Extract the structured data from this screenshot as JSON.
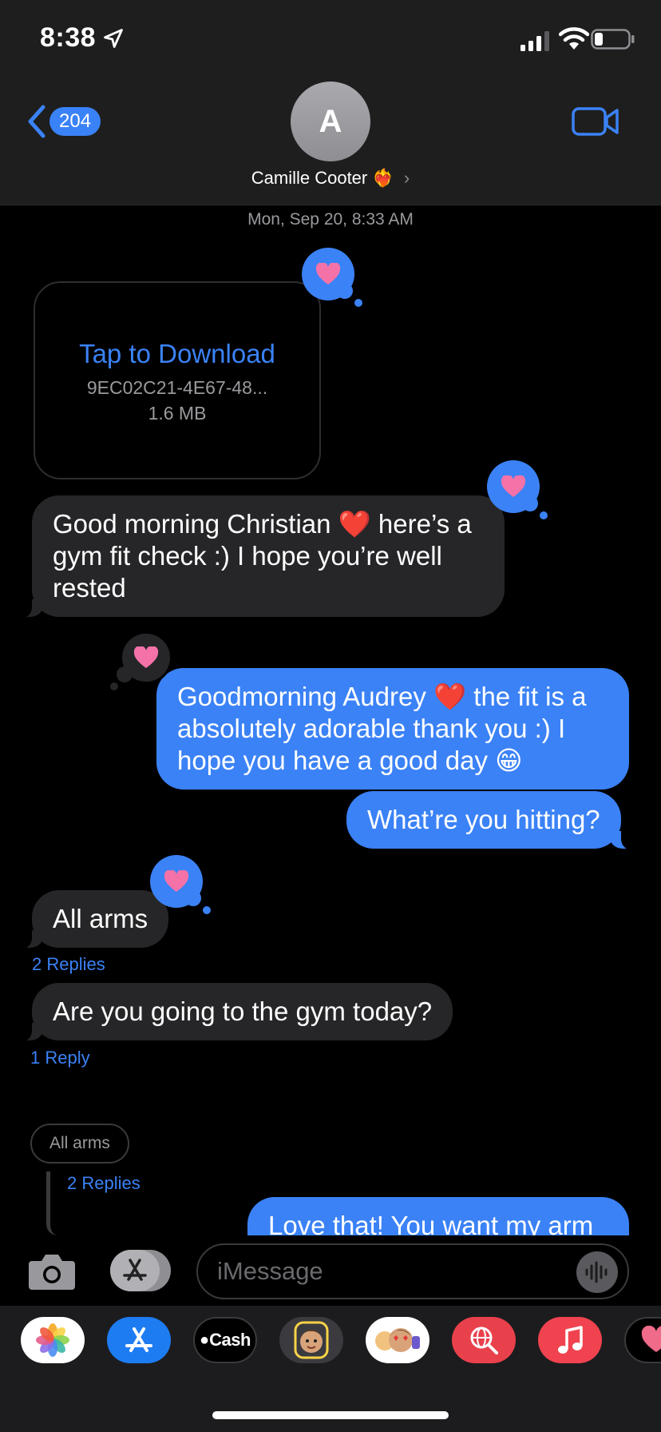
{
  "status_bar": {
    "time": "8:38"
  },
  "header": {
    "back_count": "204",
    "avatar_initial": "A",
    "contact_name": "Camille Cooter",
    "contact_emoji": "❤️‍🔥",
    "contact_chevron": "›"
  },
  "conversation": {
    "timestamp": "Mon, Sep 20, 8:33 AM",
    "attachment": {
      "title": "Tap to Download",
      "filename": "9EC02C21-4E67-48...",
      "size": "1.6 MB",
      "reaction": "heart"
    },
    "messages": [
      {
        "text": "Good morning Christian ❤️ here’s a gym fit check :) I hope you’re well rested",
        "direction": "incoming",
        "reaction": "heart"
      },
      {
        "text": "Goodmorning Audrey ❤️ the fit is a absolutely adorable thank you :) I hope you have a good day 😁",
        "direction": "outgoing",
        "reaction": "heart"
      },
      {
        "text": "What’re you hitting?",
        "direction": "outgoing"
      },
      {
        "text": "All arms",
        "direction": "incoming",
        "reaction": "heart",
        "replies": "2 Replies"
      },
      {
        "text": "Are you going to the gym today?",
        "direction": "incoming",
        "replies": "1 Reply"
      }
    ],
    "thread_preview": {
      "text": "All arms",
      "replies": "2 Replies"
    },
    "partial_message": "Love that! You want my arm"
  },
  "input": {
    "placeholder": "iMessage"
  },
  "app_drawer": [
    {
      "name": "photos",
      "label": ""
    },
    {
      "name": "app-store",
      "label": ""
    },
    {
      "name": "apple-cash",
      "label": "Cash"
    },
    {
      "name": "memoji",
      "label": ""
    },
    {
      "name": "memoji-stickers",
      "label": ""
    },
    {
      "name": "image-search",
      "label": ""
    },
    {
      "name": "music",
      "label": ""
    },
    {
      "name": "digital-touch",
      "label": ""
    }
  ],
  "colors": {
    "accent": "#3b82f6",
    "incoming_bubble": "#262628",
    "heart": "#f472a8",
    "header_bg": "#1e1e1e"
  }
}
